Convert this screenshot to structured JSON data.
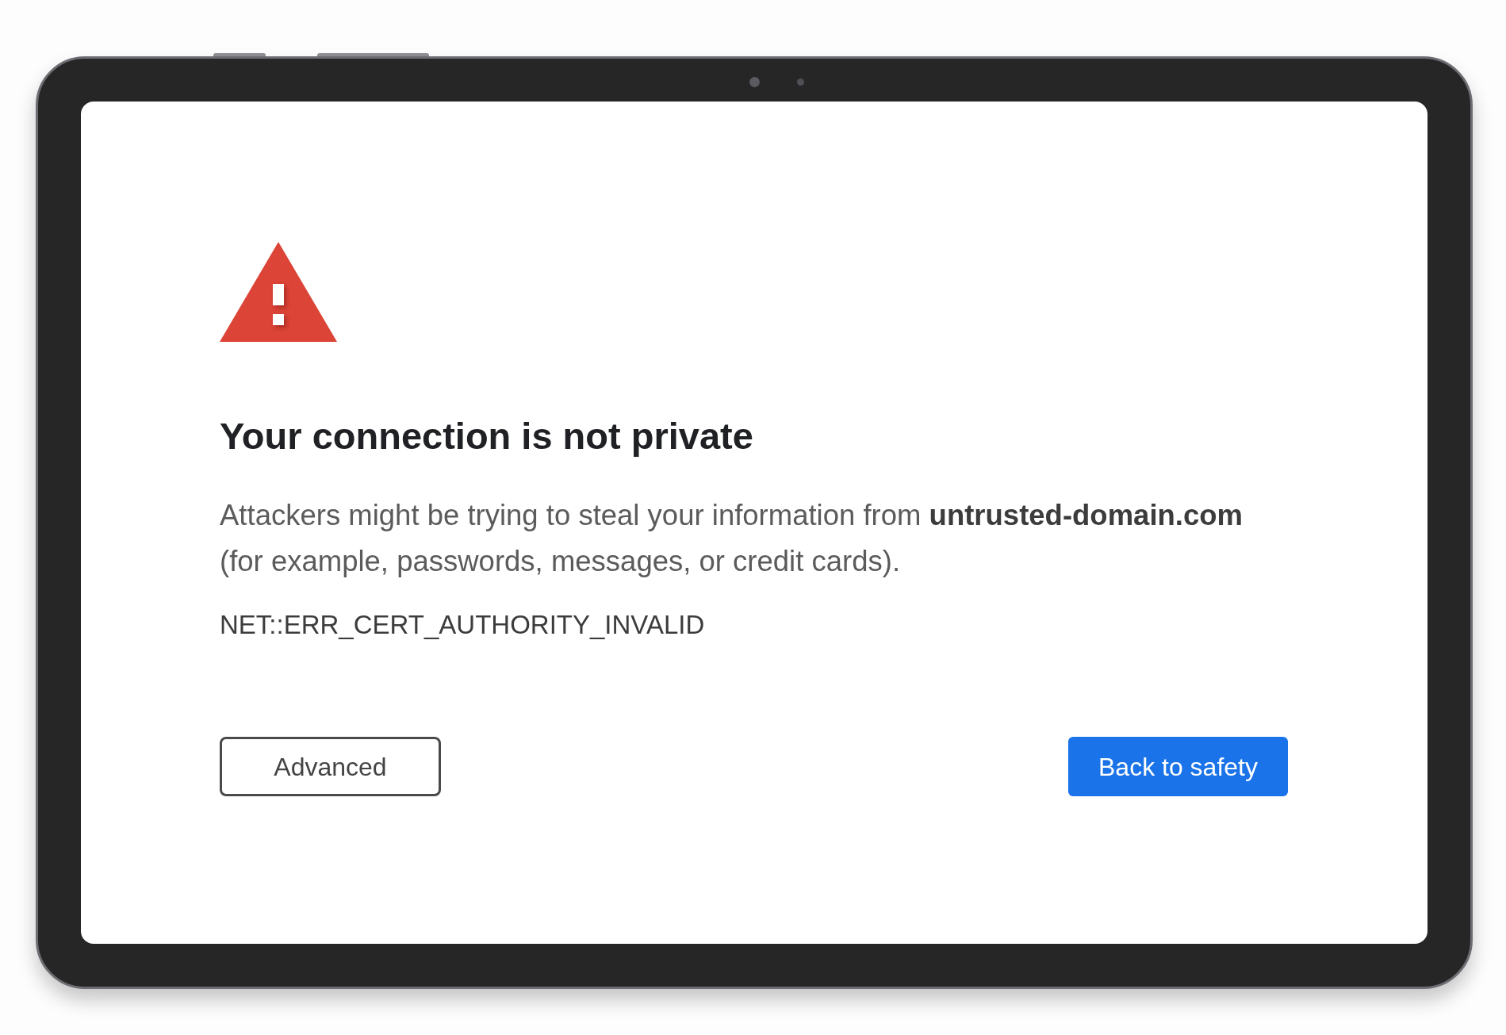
{
  "page": {
    "heading": "Your connection is not private",
    "description": "Attackers might be trying to steal your information from **untrusted-domain.com** (for example, passwords, messages, or credit cards).",
    "error_code": "NET::ERR_CERT_AUTHORITY_INVALID"
  },
  "buttons": [
    {
      "label": "Advanced",
      "kind": "secondary"
    },
    {
      "label": "Back to safety",
      "kind": "primary"
    }
  ]
}
